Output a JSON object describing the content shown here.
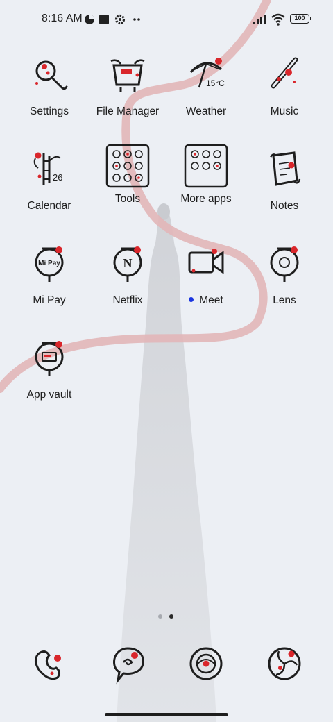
{
  "status_bar": {
    "time": "8:16 AM",
    "battery": "100",
    "icons": [
      "pie-chart-icon",
      "square-notification-icon",
      "gear-icon",
      "more-dots-icon",
      "signal-icon",
      "wifi-icon",
      "battery-icon"
    ]
  },
  "weather_widget": {
    "temperature": "15°C"
  },
  "calendar_icon": {
    "day": "26"
  },
  "apps": [
    {
      "label": "Settings"
    },
    {
      "label": "File Manager"
    },
    {
      "label": "Weather"
    },
    {
      "label": "Music"
    },
    {
      "label": "Calendar"
    },
    {
      "label": "Tools"
    },
    {
      "label": "More apps"
    },
    {
      "label": "Notes"
    },
    {
      "label": "Mi Pay"
    },
    {
      "label": "Netflix"
    },
    {
      "label": "Meet"
    },
    {
      "label": "Lens"
    },
    {
      "label": "App vault"
    }
  ],
  "mipay_icon_text": "Mi Pay",
  "netflix_icon_text": "N",
  "new_badge_color": "#1a35e0",
  "pager": {
    "pages": 2,
    "current": 2
  },
  "colors": {
    "accent_red": "#d9262b",
    "ribbon": "#e2b6b8",
    "ink": "#1e1e1e"
  }
}
